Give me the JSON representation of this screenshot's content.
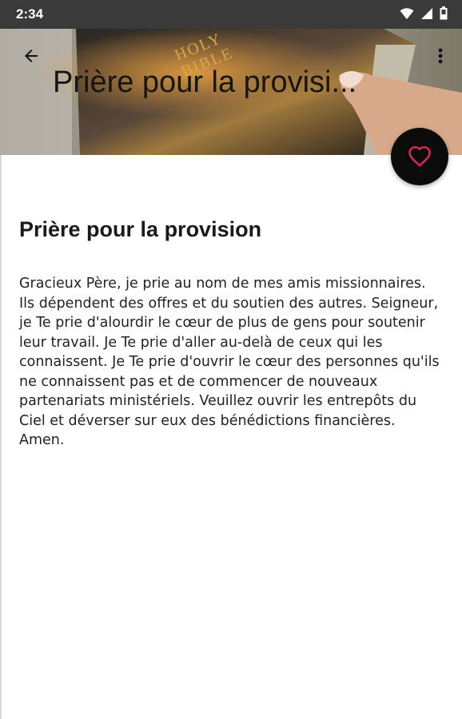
{
  "status_bar": {
    "time": "2:34",
    "icons": [
      "wifi-icon",
      "signal-icon",
      "battery-icon"
    ]
  },
  "app_bar": {
    "back_icon": "back-arrow-icon",
    "menu_icon": "more-vert-icon",
    "title": "Prière pour la provisi...",
    "header_image": "holy-bible-photo",
    "header_image_text": "HOLY BIBLE"
  },
  "fab": {
    "icon": "heart-icon",
    "accent_color": "#e0245e"
  },
  "article": {
    "heading": "Prière pour la provision",
    "body": "Gracieux Père, je prie au nom de mes amis missionnaires. Ils dépendent des offres et du soutien des autres. Seigneur, je Te prie d'alourdir le cœur de plus de gens pour soutenir leur travail. Je Te prie d'aller au-delà de ceux qui les connaissent. Je Te prie d'ouvrir le cœur des personnes qu'ils ne connaissent pas et de commencer de nouveaux partenariats ministériels. Veuillez ouvrir les entrepôts du Ciel et déverser sur eux des bénédictions financières. Amen."
  }
}
